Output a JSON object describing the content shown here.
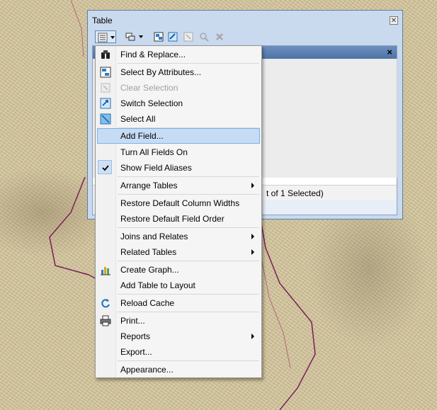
{
  "window": {
    "title": "Table",
    "close_glyph": "✕",
    "tab_close_glyph": "×",
    "status_text": "t of 1 Selected)"
  },
  "toolbar": {
    "options_icon": "table-options-icon",
    "related_icon": "related-tables-icon",
    "tools": [
      "select-by-attributes-icon",
      "switch-selection-icon",
      "clear-selection-icon",
      "zoom-to-selected-icon",
      "delete-selected-icon"
    ]
  },
  "menu": {
    "items": [
      {
        "label": "Find & Replace...",
        "icon": "binoculars-icon",
        "enabled": true
      },
      {
        "label": "Select By Attributes...",
        "icon": "select-by-attributes-icon",
        "enabled": true
      },
      {
        "label": "Clear Selection",
        "icon": "clear-selection-icon",
        "enabled": false
      },
      {
        "label": "Switch Selection",
        "icon": "switch-selection-icon",
        "enabled": true
      },
      {
        "label": "Select All",
        "icon": "select-all-icon",
        "enabled": true
      },
      {
        "label": "Add Field...",
        "icon": "",
        "enabled": true,
        "highlighted": true
      },
      {
        "label": "Turn All Fields On",
        "icon": "",
        "enabled": true
      },
      {
        "label": "Show Field Aliases",
        "icon": "check-icon",
        "enabled": true,
        "checked": true
      },
      {
        "label": "Arrange Tables",
        "icon": "",
        "enabled": true,
        "submenu": true
      },
      {
        "label": "Restore Default Column Widths",
        "icon": "",
        "enabled": true
      },
      {
        "label": "Restore Default Field Order",
        "icon": "",
        "enabled": true
      },
      {
        "label": "Joins and Relates",
        "icon": "",
        "enabled": true,
        "submenu": true
      },
      {
        "label": "Related Tables",
        "icon": "",
        "enabled": true,
        "submenu": true
      },
      {
        "label": "Create Graph...",
        "icon": "bar-chart-icon",
        "enabled": true
      },
      {
        "label": "Add Table to Layout",
        "icon": "",
        "enabled": true
      },
      {
        "label": "Reload Cache",
        "icon": "reload-icon",
        "enabled": true
      },
      {
        "label": "Print...",
        "icon": "printer-icon",
        "enabled": true
      },
      {
        "label": "Reports",
        "icon": "",
        "enabled": true,
        "submenu": true
      },
      {
        "label": "Export...",
        "icon": "",
        "enabled": true
      },
      {
        "label": "Appearance...",
        "icon": "",
        "enabled": true
      }
    ]
  },
  "colors": {
    "highlight": "#c6dcf5",
    "window_frame": "#c9d9ee",
    "map_line": "#7a1e5a"
  }
}
